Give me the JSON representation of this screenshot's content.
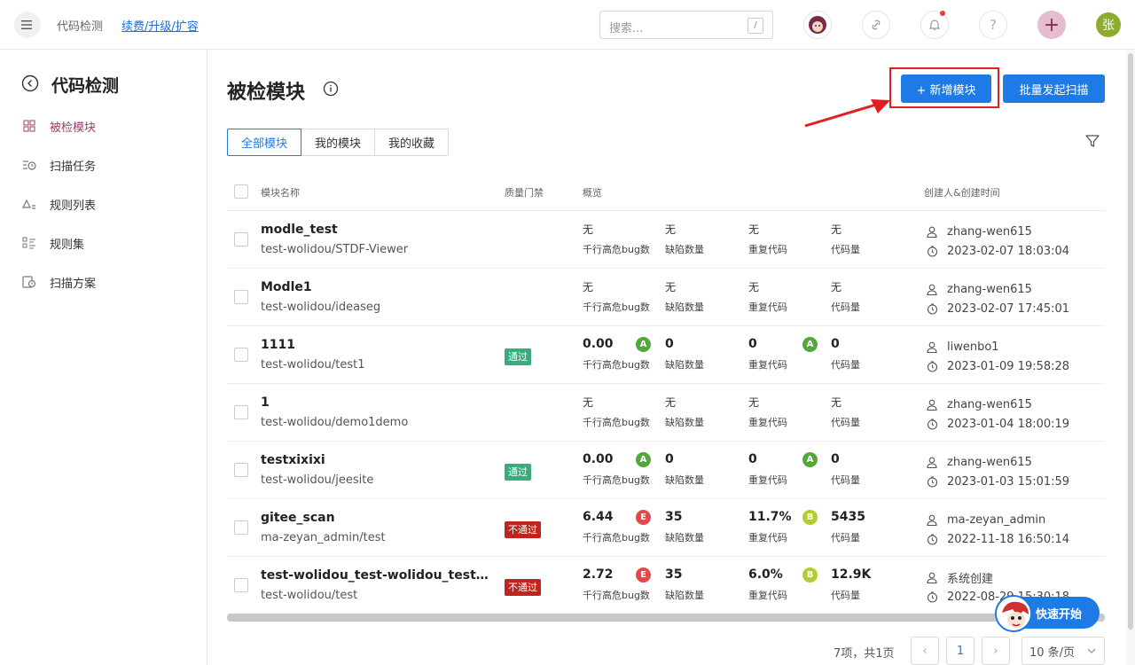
{
  "header": {
    "app_name": "代码检测",
    "renew_link": "续费/升级/扩容",
    "search_placeholder": "搜索...",
    "search_shortcut": "/",
    "user_avatar": "张"
  },
  "sidebar": {
    "title": "代码检测",
    "items": [
      {
        "label": "被检模块",
        "active": true
      },
      {
        "label": "扫描任务"
      },
      {
        "label": "规则列表"
      },
      {
        "label": "规则集"
      },
      {
        "label": "扫描方案"
      }
    ]
  },
  "main": {
    "title": "被检模块",
    "add_button": "+ 新增模块",
    "batch_button": "批量发起扫描",
    "tabs": [
      "全部模块",
      "我的模块",
      "我的收藏"
    ],
    "columns": {
      "name": "模块名称",
      "gate": "质量门禁",
      "overview": "概览",
      "creator": "创建人&创建时间"
    },
    "metric_labels": [
      "千行高危bug数",
      "缺陷数量",
      "重复代码",
      "代码量"
    ],
    "rows": [
      {
        "name": "modle_test",
        "path": "test-wolidou/STDF-Viewer",
        "gate": "",
        "m1": "无",
        "g1": "",
        "m2": "无",
        "m3": "无",
        "g3": "",
        "m4": "无",
        "creator": "zhang-wen615",
        "time": "2023-02-07 18:03:04"
      },
      {
        "name": "Modle1",
        "path": "test-wolidou/ideaseg",
        "gate": "",
        "m1": "无",
        "g1": "",
        "m2": "无",
        "m3": "无",
        "g3": "",
        "m4": "无",
        "creator": "zhang-wen615",
        "time": "2023-02-07 17:45:01"
      },
      {
        "name": "1111",
        "path": "test-wolidou/test1",
        "gate": "通过",
        "m1": "0.00",
        "g1": "A",
        "m2": "0",
        "m3": "0",
        "g3": "A",
        "m4": "0",
        "creator": "liwenbo1",
        "time": "2023-01-09 19:58:28"
      },
      {
        "name": "1",
        "path": "test-wolidou/demo1demo",
        "gate": "",
        "m1": "无",
        "g1": "",
        "m2": "无",
        "m3": "无",
        "g3": "",
        "m4": "无",
        "creator": "zhang-wen615",
        "time": "2023-01-04 18:00:19"
      },
      {
        "name": "testxixixi",
        "path": "test-wolidou/jeesite",
        "gate": "通过",
        "m1": "0.00",
        "g1": "A",
        "m2": "0",
        "m3": "0",
        "g3": "A",
        "m4": "0",
        "creator": "zhang-wen615",
        "time": "2023-01-03 15:01:59"
      },
      {
        "name": "gitee_scan",
        "path": "ma-zeyan_admin/test",
        "gate": "不通过",
        "m1": "6.44",
        "g1": "E",
        "m2": "35",
        "m3": "11.7%",
        "g3": "B",
        "m4": "5435",
        "creator": "ma-zeyan_admin",
        "time": "2022-11-18 16:50:14"
      },
      {
        "name": "test-wolidou_test-wolidou_test_op...",
        "path": "test-wolidou/test",
        "gate": "不通过",
        "m1": "2.72",
        "g1": "E",
        "m2": "35",
        "m3": "6.0%",
        "g3": "B",
        "m4": "12.9K",
        "creator": "系统创建",
        "time": "2022-08-29 15:30:18"
      }
    ]
  },
  "pagination": {
    "summary": "7项，共1页",
    "current_page": "1",
    "page_size": "10 条/页"
  },
  "quick_start": "快速开始"
}
